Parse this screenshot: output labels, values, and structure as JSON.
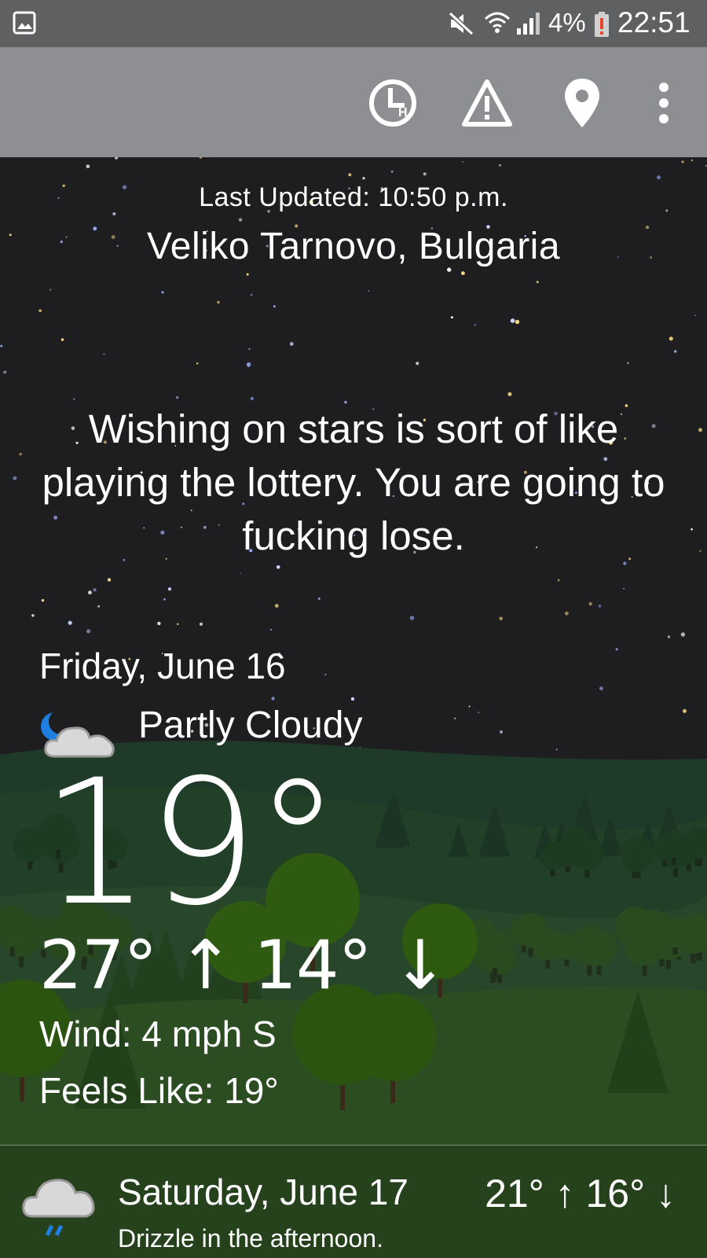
{
  "status_bar": {
    "battery": "4%",
    "time": "22:51"
  },
  "toolbar": {
    "icons": [
      "history-icon",
      "alert-icon",
      "location-pin-icon",
      "more-vert-icon"
    ]
  },
  "header": {
    "last_updated": "Last Updated: 10:50 p.m.",
    "location": "Veliko Tarnovo, Bulgaria"
  },
  "quote": "Wishing on stars is sort of like playing the lottery. You are going to fucking lose.",
  "current": {
    "date": "Friday, June 16",
    "condition": "Partly Cloudy",
    "condition_icon": "partly-cloudy-night-icon",
    "temperature": "19°",
    "high_low": "27° ↑ 14° ↓",
    "wind": "Wind: 4 mph S",
    "feels_like": "Feels Like: 19°"
  },
  "forecast": [
    {
      "day": "Saturday, June 17",
      "description": "Drizzle in the afternoon.",
      "high_low": "21° ↑ 16° ↓",
      "icon": "drizzle-icon"
    }
  ],
  "colors": {
    "status_bar": "#5f6062",
    "toolbar": "#8e8f92",
    "night_sky": "#1e1e20",
    "hills": "#2a4a22",
    "moon": "#1e7fe0"
  }
}
